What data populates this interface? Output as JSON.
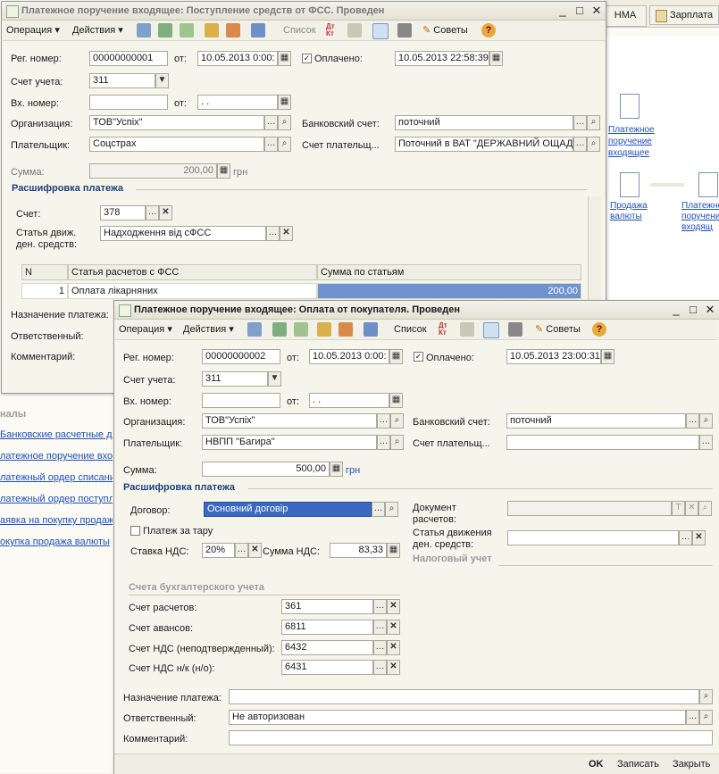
{
  "background_tabs": {
    "hma": "НМА",
    "zarplata": "Зарплата"
  },
  "background_links": {
    "section": "налы",
    "items": [
      "Банковские расчетные до",
      "латежное поручение вхо",
      "латежный ордер списани",
      "латежный ордер поступл",
      "аявка на покупку продаж",
      "окупка продажа валюты"
    ]
  },
  "background_icons": [
    {
      "label": "Платежное поручение входящее"
    },
    {
      "label": "Продажа валюты"
    },
    {
      "label": "Платежное поручение входящ"
    }
  ],
  "win1": {
    "title": "Платежное поручение входящее: Поступление средств от ФСС. Проведен",
    "toolbar": {
      "operation": "Операция",
      "actions": "Действия",
      "list": "Список",
      "advice": "Советы"
    },
    "labels": {
      "reg": "Рег. номер:",
      "from": "от:",
      "paid": "Оплачено:",
      "account": "Счет учета:",
      "in_num": "Вх. номер:",
      "org": "Организация:",
      "bank": "Банковский счет:",
      "payer": "Плательщик:",
      "payer_acc": "Счет плательщ...",
      "sum": "Сумма:",
      "currency": "грн",
      "account2": "Счет:",
      "cash_item": "Статья движ. ден. средств:",
      "purpose": "Назначение платежа:",
      "responsible": "Ответственный:",
      "comment": "Комментарий:"
    },
    "values": {
      "reg": "00000000001",
      "date": "10.05.2013 0:00:",
      "paid_date": "10.05.2013 22:58:39",
      "account": "311",
      "in_date": " .  .",
      "org": "ТОВ\"Успіх\"",
      "bank": "поточний",
      "payer": "Соцстрах",
      "payer_acc": "Поточний в ВАТ \"ДЕРЖАВНИЙ ОЩАД",
      "sum": "200,00",
      "account2": "378",
      "cash_item": "Надходження від сФСС"
    },
    "section": "Расшифровка платежа",
    "grid": {
      "headers": [
        "N",
        "Статья расчетов с ФСС",
        "Сумма по статьям"
      ],
      "rows": [
        {
          "n": "1",
          "item": "Оплата лікарняних",
          "sum": "200,00"
        }
      ]
    }
  },
  "win2": {
    "title": "Платежное поручение входящее: Оплата от покупателя. Проведен",
    "toolbar": {
      "operation": "Операция",
      "actions": "Действия",
      "list": "Список",
      "advice": "Советы"
    },
    "labels": {
      "reg": "Рег. номер:",
      "from": "от:",
      "paid": "Оплачено:",
      "account": "Счет учета:",
      "in_num": "Вх. номер:",
      "org": "Организация:",
      "bank": "Банковский счет:",
      "payer": "Плательщик:",
      "payer_acc": "Счет плательщ...",
      "sum": "Сумма:",
      "currency": "грн",
      "contract": "Договор:",
      "tare": "Платеж за тару",
      "vat_rate": "Ставка НДС:",
      "vat_sum": "Сумма НДС:",
      "doc": "Документ расчетов:",
      "cash_item": "Статья движения ден. средств:",
      "tax": "Налоговый учет",
      "acc_section": "Счета бухгалтерского учета",
      "settle": "Счет расчетов:",
      "advances": "Счет авансов:",
      "vat_unconf": "Счет НДС (неподтвержденный):",
      "vat_nk": "Счет НДС н/к (н/о):",
      "purpose": "Назначение платежа:",
      "responsible": "Ответственный:",
      "comment": "Комментарий:"
    },
    "values": {
      "reg": "00000000002",
      "date": "10.05.2013 0:00:",
      "paid_date": "10.05.2013 23:00:31",
      "account": "311",
      "in_date": " .  .",
      "org": "ТОВ\"Успіх\"",
      "bank": "поточний",
      "payer": "НВПП \"Багира\"",
      "sum": "500,00",
      "contract": "Основний договір",
      "vat_rate": "20%",
      "vat_sum": "83,33",
      "settle": "361",
      "advances": "6811",
      "vat_unconf": "6432",
      "vat_nk": "6431",
      "responsible": "Не авторизован"
    },
    "section": "Расшифровка платежа",
    "footer": {
      "ok": "OK",
      "save": "Записать",
      "close": "Закрыть"
    }
  }
}
